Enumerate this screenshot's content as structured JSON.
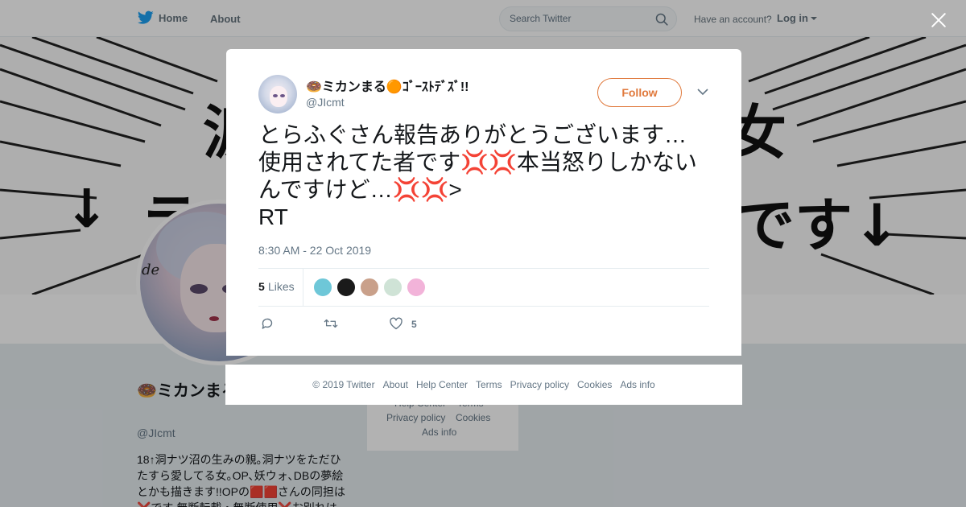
{
  "nav": {
    "home_label": "Home",
    "about_label": "About",
    "search_placeholder": "Search Twitter",
    "have_account": "Have an account?",
    "login_label": "Log in"
  },
  "background_profile": {
    "banner_chars": [
      "涙",
      "女",
      "↓",
      "ラ",
      "です↓"
    ],
    "signature": "de",
    "name": "🍩ミカンまる🟠ｺﾞｰｽﾄﾃﾞｽﾞ!!",
    "handle": "@JIcmt",
    "bio": "18↑洞ナツ沼の生みの親｡洞ナツをただひたすら愛してる女｡OP､妖ウォ､DBの夢絵とかも描きます!!OPの🟥🟥さんの同担は❌です 無断転載・無断使用❌お別れは",
    "footer_links": [
      "Help Center",
      "Terms",
      "Privacy policy",
      "Cookies",
      "Ads info"
    ]
  },
  "tweet": {
    "author_name": "🍩ミカンまる🟠ｺﾞｰｽﾄﾃﾞｽﾞ!!",
    "author_handle": "@JIcmt",
    "follow_label": "Follow",
    "text": "とらふぐさん報告ありがとうございます…\n使用されてた者です💢💢本当怒りしかないんですけど…💢💢>\nRT",
    "timestamp": "8:30 AM - 22 Oct 2019",
    "likes_count": "5",
    "likes_label": "Likes",
    "like_action_count": "5",
    "liker_colors": [
      "#6ec7d8",
      "#1a1a1a",
      "#c9a08a",
      "#cfe3d6",
      "#f2b3d9"
    ]
  },
  "footer": {
    "copyright": "© 2019 Twitter",
    "links": [
      "About",
      "Help Center",
      "Terms",
      "Privacy policy",
      "Cookies",
      "Ads info"
    ]
  },
  "colors": {
    "accent": "#e0793c",
    "twitter_blue": "#1da1f2",
    "muted": "#657786"
  }
}
